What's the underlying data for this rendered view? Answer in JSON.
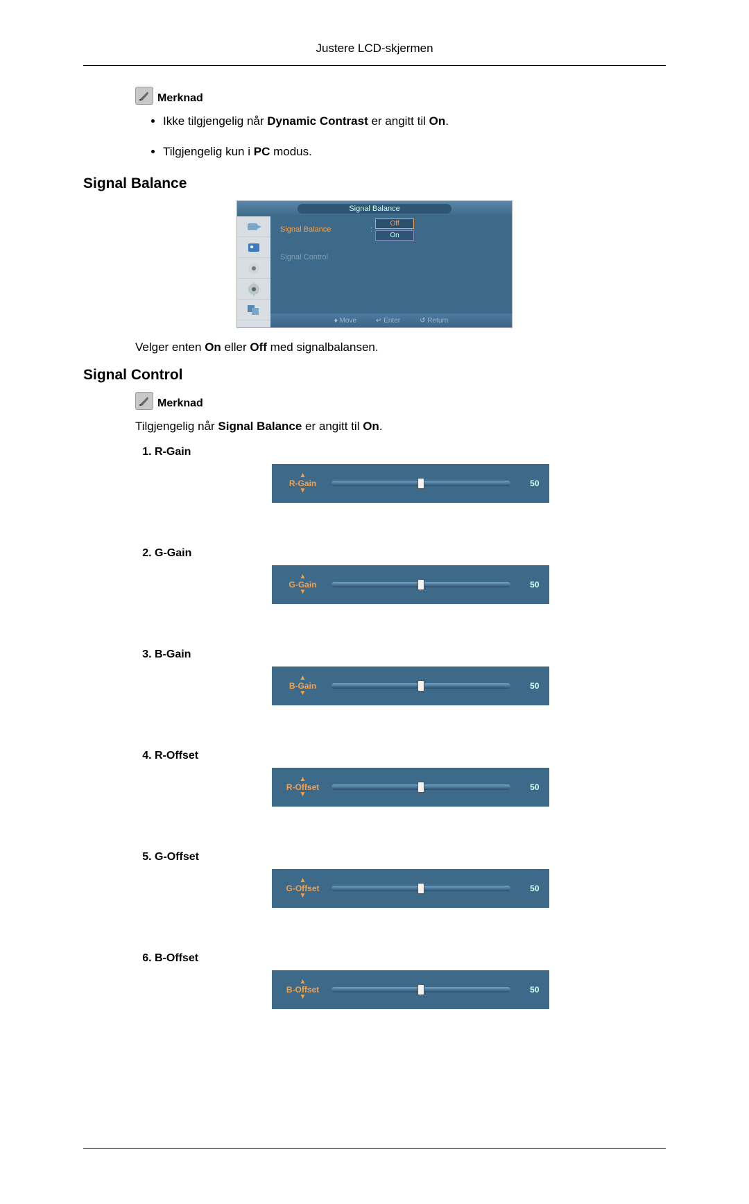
{
  "header": {
    "title": "Justere LCD-skjermen"
  },
  "note1": {
    "label": "Merknad",
    "bullets": {
      "b1_pre": "Ikke tilgjengelig når ",
      "b1_bold1": "Dynamic Contrast",
      "b1_mid": " er angitt til ",
      "b1_bold2": "On",
      "b1_end": ".",
      "b2_pre": "Tilgjengelig kun i ",
      "b2_bold": "PC",
      "b2_end": " modus."
    }
  },
  "section_balance": {
    "title": "Signal Balance",
    "osd": {
      "title": "Signal Balance",
      "row1": "Signal Balance",
      "row2": "Signal Control",
      "opt_off": "Off",
      "opt_on": "On",
      "footer_move": "Move",
      "footer_enter": "Enter",
      "footer_return": "Return"
    },
    "desc_pre": "Velger enten ",
    "desc_b1": "On",
    "desc_mid": " eller ",
    "desc_b2": "Off",
    "desc_end": " med signalbalansen."
  },
  "section_control": {
    "title": "Signal Control",
    "note_label": "Merknad",
    "desc_pre": "Tilgjengelig når ",
    "desc_b1": "Signal Balance",
    "desc_mid": " er angitt til ",
    "desc_b2": "On",
    "desc_end": ".",
    "items": [
      {
        "name": "R-Gain",
        "slider_label": "R-Gain",
        "value": "50"
      },
      {
        "name": "G-Gain",
        "slider_label": "G-Gain",
        "value": "50"
      },
      {
        "name": "B-Gain",
        "slider_label": "B-Gain",
        "value": "50"
      },
      {
        "name": "R-Offset",
        "slider_label": "R-Offset",
        "value": "50"
      },
      {
        "name": "G-Offset",
        "slider_label": "G-Offset",
        "value": "50"
      },
      {
        "name": "B-Offset",
        "slider_label": "B-Offset",
        "value": "50"
      }
    ]
  }
}
